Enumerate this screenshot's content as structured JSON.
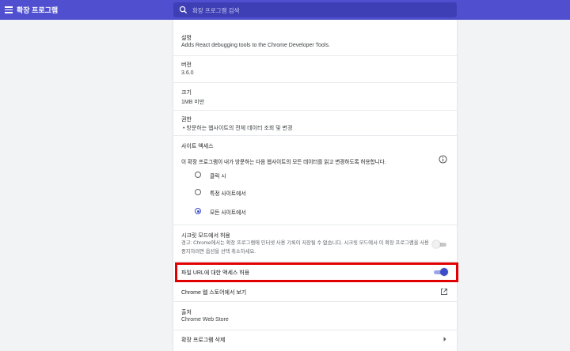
{
  "header": {
    "title": "확장 프로그램",
    "search_placeholder": "확장 프로그램 검색"
  },
  "details": {
    "description_label": "설명",
    "description_value": "Adds React debugging tools to the Chrome Developer Tools.",
    "version_label": "버전",
    "version_value": "3.6.0",
    "size_label": "크기",
    "size_value": "1MB 미만",
    "permissions_label": "권한",
    "permissions_items": [
      "방문하는 웹사이트의 전체 데이터 조회 및 변경"
    ],
    "site_access_label": "사이트 액세스",
    "site_access_desc": "이 확장 프로그램이 내가 방문하는 다음 웹사이트의 모든 데이터를 읽고 변경하도록 허용합니다.",
    "site_access_options": [
      "클릭 시",
      "특정 사이트에서",
      "모든 사이트에서"
    ],
    "site_access_selected": "모든 사이트에서",
    "incognito_label": "시크릿 모드에서 허용",
    "incognito_warning": "경고: Chrome에서는 확장 프로그램에 인터넷 사용 기록이 저장될 수 없습니다. 시크릿 모드에서 이 확장 프로그램을 사용 중지하려면 옵션을 선택 취소하세요.",
    "incognito_enabled": false,
    "file_url_label": "파일 URL에 대한 액세스 허용",
    "file_url_enabled": true,
    "webstore_link": "Chrome 웹 스토어에서 보기",
    "source_label": "출처",
    "source_value": "Chrome Web Store",
    "remove_label": "확장 프로그램 삭제"
  },
  "colors": {
    "header": "#4f4fcf",
    "accent": "#3c4cc9",
    "highlight_border": "#e00000"
  },
  "icons": [
    "menu-icon",
    "search-icon",
    "info-icon",
    "open-in-new-icon",
    "chevron-right-icon"
  ]
}
